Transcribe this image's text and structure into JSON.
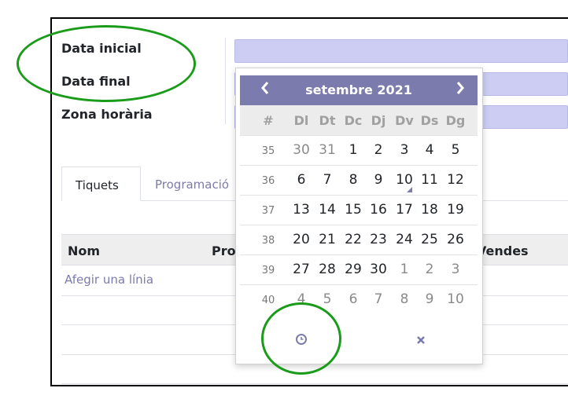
{
  "form": {
    "start_label": "Data inicial",
    "end_label": "Data final",
    "timezone_label": "Zona horària"
  },
  "tabs": [
    {
      "label": "Tiquets"
    },
    {
      "label": "Programació"
    }
  ],
  "table": {
    "columns": [
      "Nom",
      "Pro",
      "Vendes"
    ],
    "add_line": "Afegir una línia"
  },
  "datepicker": {
    "month_title": "setembre 2021",
    "prev_icon": "chevron-left-icon",
    "next_icon": "chevron-right-icon",
    "week_header": "#",
    "weekdays": [
      "Dl",
      "Dt",
      "Dc",
      "Dj",
      "Dv",
      "Ds",
      "Dg"
    ],
    "weeks": [
      {
        "num": "35",
        "days": [
          "30",
          "31",
          "1",
          "2",
          "3",
          "4",
          "5"
        ]
      },
      {
        "num": "36",
        "days": [
          "6",
          "7",
          "8",
          "9",
          "10",
          "11",
          "12"
        ]
      },
      {
        "num": "37",
        "days": [
          "13",
          "14",
          "15",
          "16",
          "17",
          "18",
          "19"
        ]
      },
      {
        "num": "38",
        "days": [
          "20",
          "21",
          "22",
          "23",
          "24",
          "25",
          "26"
        ]
      },
      {
        "num": "39",
        "days": [
          "27",
          "28",
          "29",
          "30",
          "1",
          "2",
          "3"
        ]
      },
      {
        "num": "40",
        "days": [
          "4",
          "5",
          "6",
          "7",
          "8",
          "9",
          "10"
        ]
      }
    ],
    "today": "10",
    "time_icon": "clock-icon",
    "clear_icon": "close-icon",
    "accent": "#7c7bad"
  },
  "annotations": {
    "highlight_color": "#1a9c1a"
  }
}
